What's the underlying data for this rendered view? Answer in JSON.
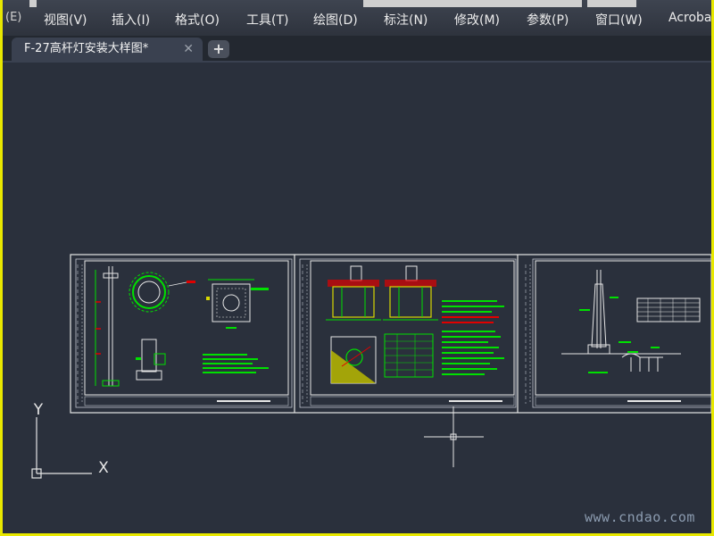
{
  "menubar": {
    "faded_prefix": "(E)",
    "items": [
      "视图(V)",
      "插入(I)",
      "格式(O)",
      "工具(T)",
      "绘图(D)",
      "标注(N)",
      "修改(M)",
      "参数(P)",
      "窗口(W)",
      "Acrobat"
    ]
  },
  "tabs": {
    "active_title": "F-27高杆灯安装大样图*",
    "close_glyph": "✕",
    "new_tab_glyph": "+"
  },
  "ucs": {
    "y_label": "Y",
    "x_label": "X"
  },
  "watermark": "www.cndao.com",
  "colors": {
    "canvas": "#2a303c",
    "drawing_white": "#e6e6e6",
    "drawing_green": "#00e000",
    "drawing_red": "#e00000",
    "drawing_yellow": "#d8d800",
    "frame_yellow": "#e8e800"
  },
  "icons": [
    "close-icon",
    "plus-icon",
    "crosshair-cursor-icon",
    "ucs-icon"
  ]
}
